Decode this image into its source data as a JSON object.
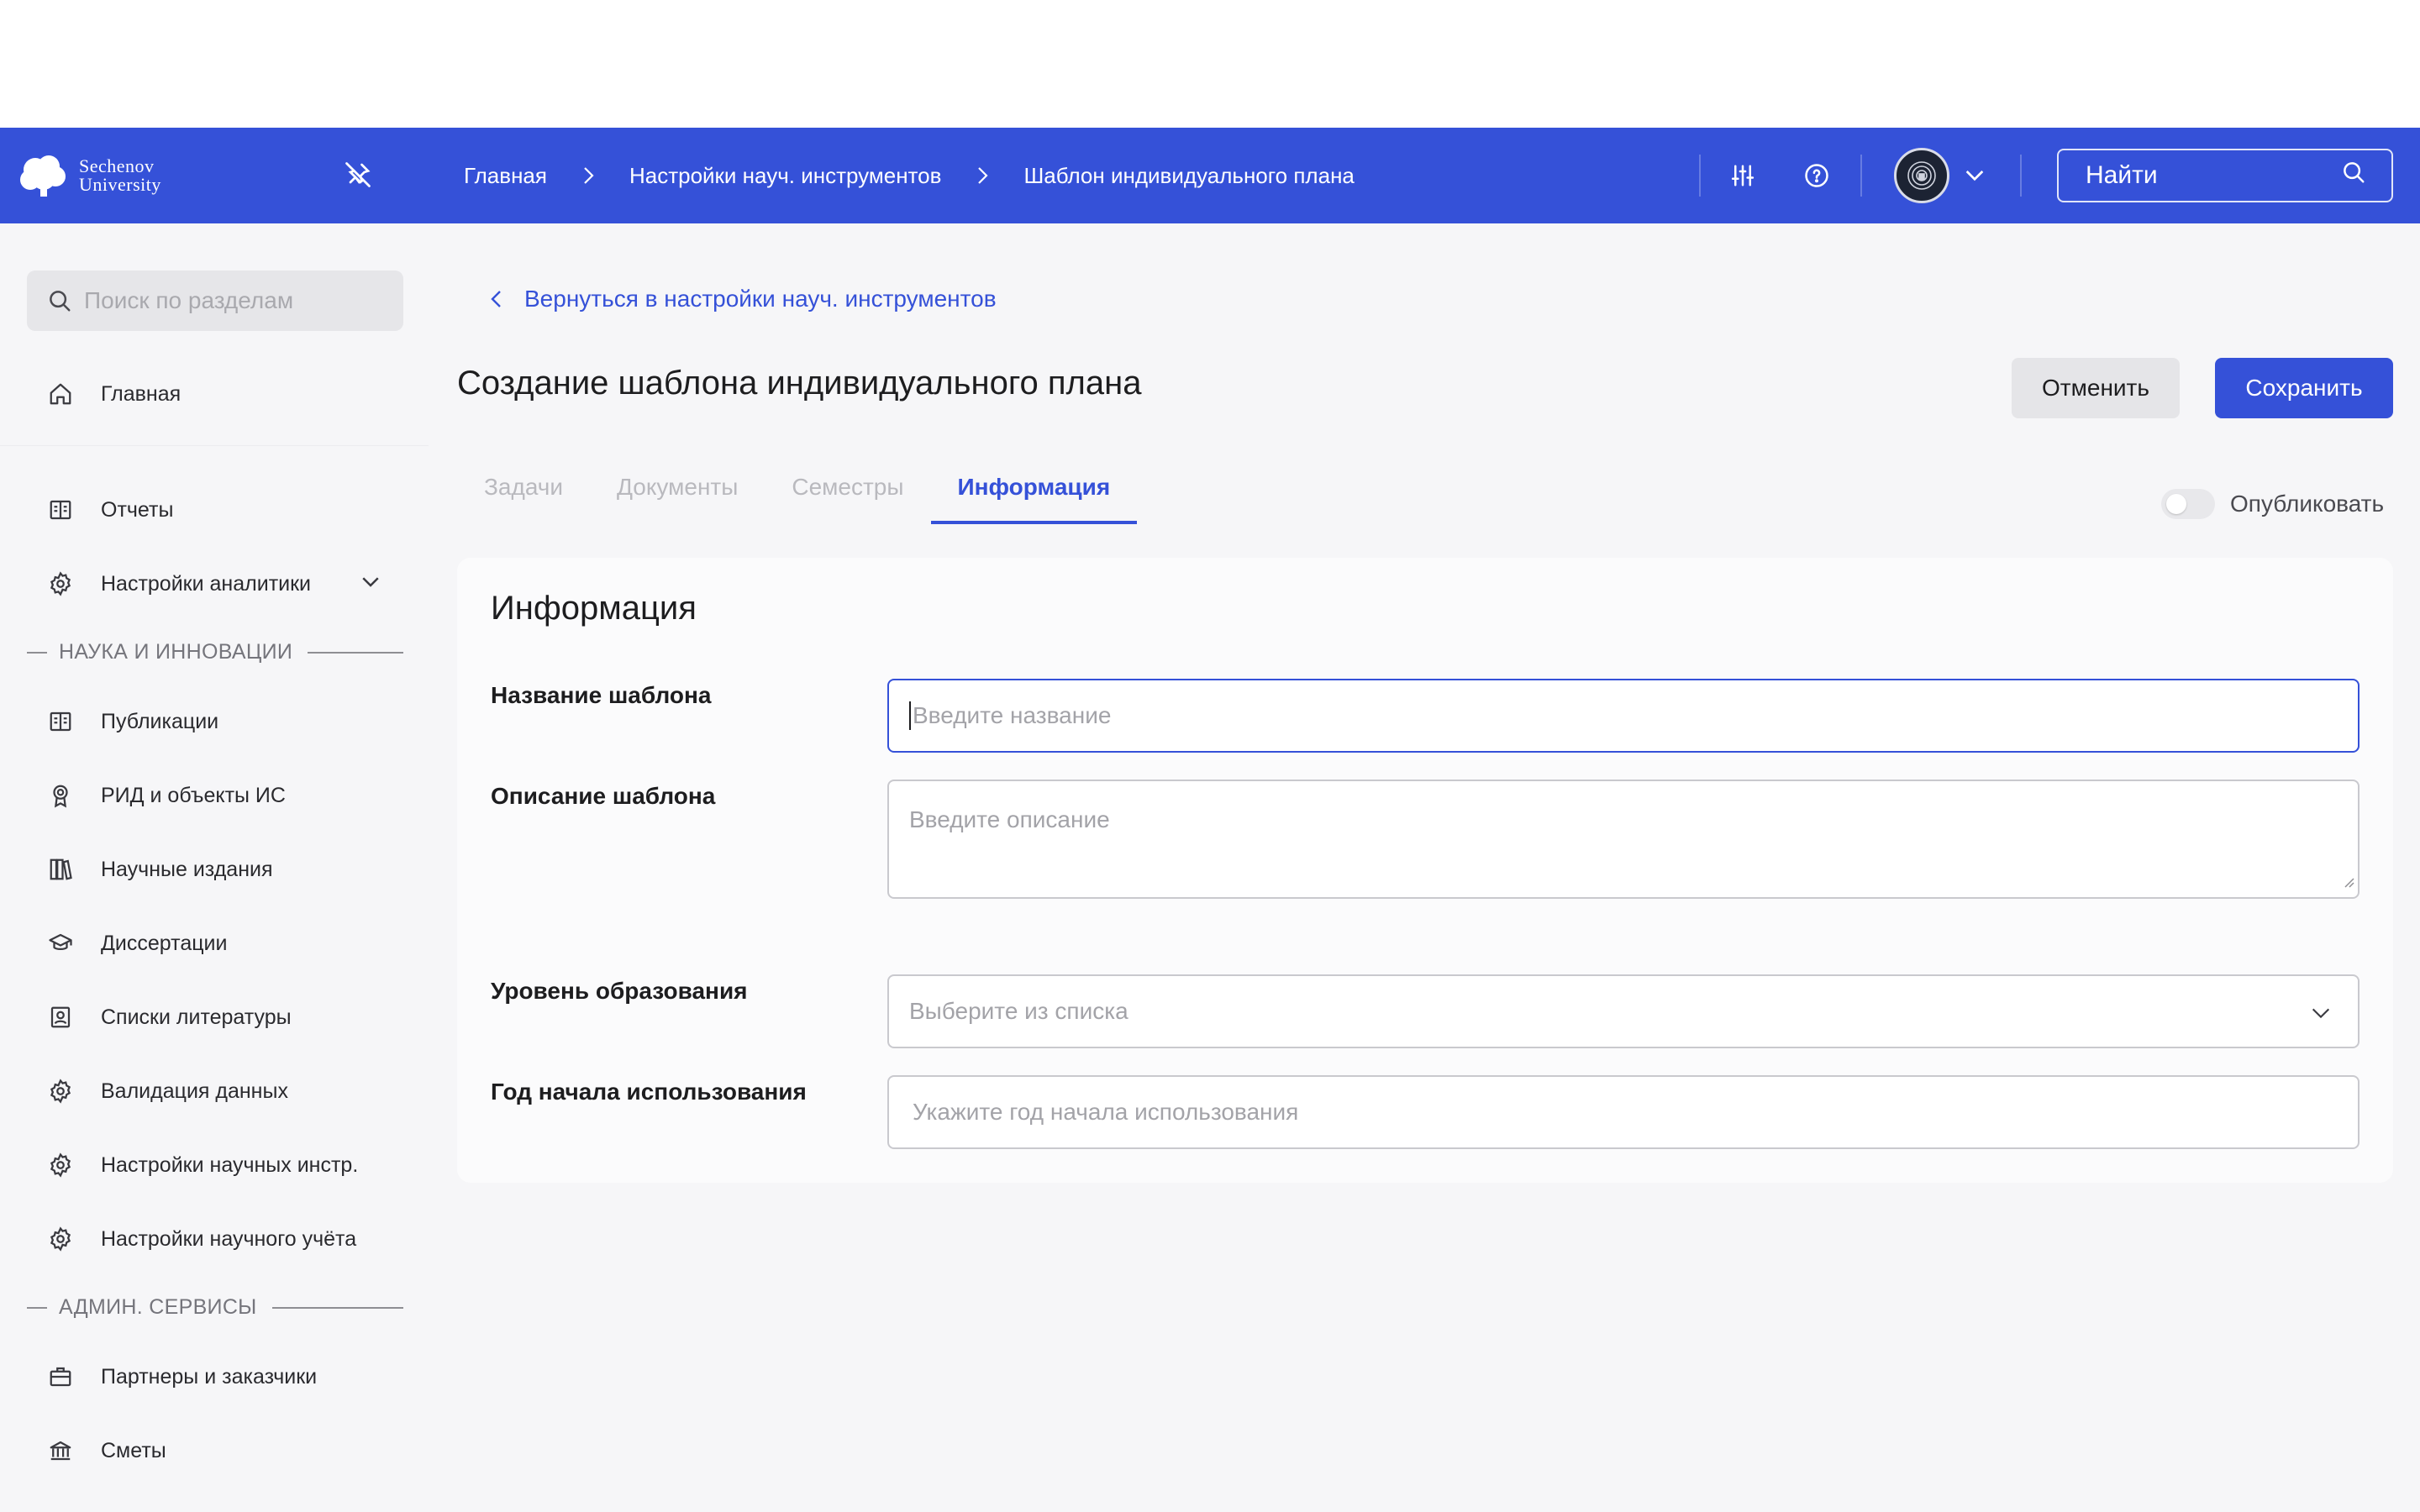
{
  "header": {
    "logo_line1": "Sechenov",
    "logo_line2": "University",
    "breadcrumbs": [
      "Главная",
      "Настройки науч. инструментов",
      "Шаблон индивидуального плана"
    ],
    "search_placeholder": "Найти",
    "bg_color": "#3551d8"
  },
  "sidebar": {
    "search_placeholder": "Поиск по разделам",
    "items_top": [
      {
        "label": "Главная",
        "icon": "home-icon"
      },
      {
        "label": "Отчеты",
        "icon": "book-open-icon"
      },
      {
        "label": "Настройки аналитики",
        "icon": "gear-icon"
      }
    ],
    "section_science": "НАУКА И ИННОВАЦИИ",
    "items_science": [
      {
        "label": "Публикации",
        "icon": "book-open-icon"
      },
      {
        "label": "РИД и объекты ИС",
        "icon": "award-icon"
      },
      {
        "label": "Научные издания",
        "icon": "books-icon"
      },
      {
        "label": "Диссертации",
        "icon": "graduation-cap-icon"
      },
      {
        "label": "Списки литературы",
        "icon": "contact-book-icon"
      },
      {
        "label": "Валидация данных",
        "icon": "gear-icon"
      },
      {
        "label": "Настройки научных инстр.",
        "icon": "gear-icon"
      },
      {
        "label": "Настройки научного учёта",
        "icon": "gear-icon"
      }
    ],
    "section_admin": "АДМИН. СЕРВИСЫ",
    "items_admin": [
      {
        "label": "Партнеры и заказчики",
        "icon": "briefcase-icon"
      },
      {
        "label": "Сметы",
        "icon": "bank-icon"
      }
    ]
  },
  "main": {
    "back_link": "Вернуться в настройки науч. инструментов",
    "title": "Создание шаблона индивидуального плана",
    "cancel_label": "Отменить",
    "save_label": "Сохранить",
    "tabs": [
      "Задачи",
      "Документы",
      "Семестры",
      "Информация"
    ],
    "active_tab": "Информация",
    "publish_label": "Опубликовать",
    "publish_on": false
  },
  "form": {
    "card_title": "Информация",
    "name_label": "Название шаблона",
    "name_placeholder": "Введите название",
    "desc_label": "Описание шаблона",
    "desc_placeholder": "Введите описание",
    "level_label": "Уровень образования",
    "level_placeholder": "Выберите из списка",
    "year_label": "Год начала использования",
    "year_placeholder": "Укажите год начала использования"
  }
}
